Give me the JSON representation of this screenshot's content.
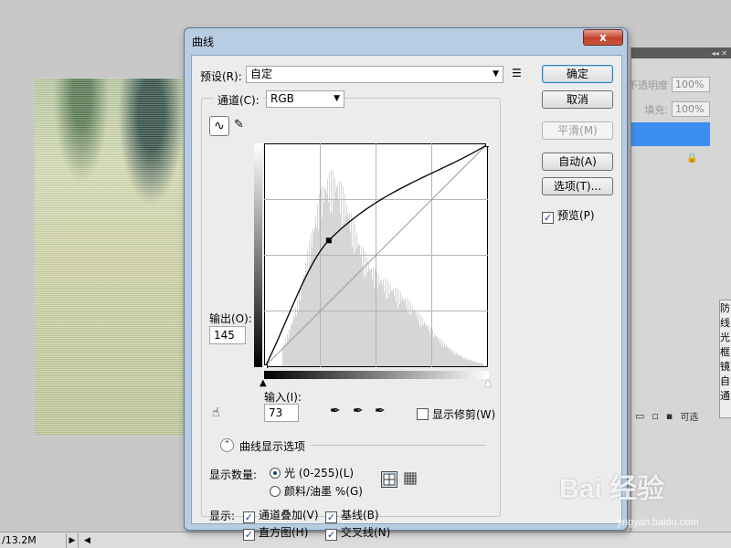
{
  "status": {
    "zoom_text": "/13.2M",
    "arrow": "▶",
    "scroll_arrow": "◀"
  },
  "layers_panel": {
    "opacity_label": "不透明度:",
    "opacity_value": "100%",
    "fill_label": "填充:",
    "fill_value": "100%",
    "side_labels": [
      "防",
      "线",
      "光",
      "框",
      "镜",
      "自",
      "通",
      "可选"
    ]
  },
  "dialog": {
    "title": "曲线",
    "close_symbol": "x",
    "preset_label": "预设(R):",
    "preset_value": "自定",
    "channel_label": "通道(C):",
    "channel_value": "RGB",
    "output_label": "输出(O):",
    "output_value": "145",
    "input_label": "输入(I):",
    "input_value": "73",
    "show_clipping_label": "显示修剪(W)",
    "curve_options_label": "曲线显示选项",
    "show_amount_label": "显示数量:",
    "radio_light_label": "光 (0-255)(L)",
    "radio_pigment_label": "颜料/油墨 %(G)",
    "show_label": "显示:",
    "cb_channel_overlay": "通道叠加(V)",
    "cb_baseline": "基线(B)",
    "cb_histogram": "直方图(H)",
    "cb_intersection": "交叉线(N)",
    "btn_ok": "确定",
    "btn_cancel": "取消",
    "btn_smooth": "平滑(M)",
    "btn_auto": "自动(A)",
    "btn_options": "选项(T)...",
    "preview_label": "预览(P)",
    "checkmark": "✓",
    "light_selected": true
  },
  "curve": {
    "points": [
      [
        0,
        0
      ],
      [
        73,
        145
      ],
      [
        255,
        255
      ]
    ]
  },
  "watermark": {
    "main": "Bai 经验",
    "sub": "jingyan.baidu.com"
  }
}
